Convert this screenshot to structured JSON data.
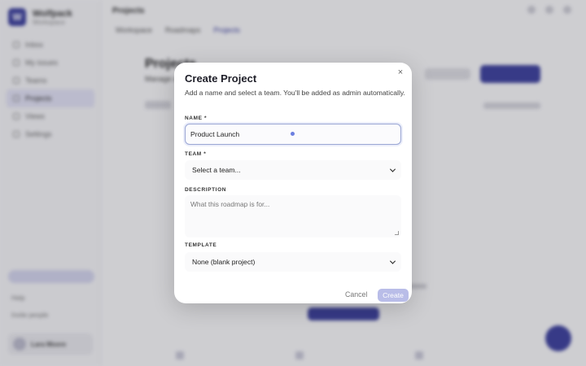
{
  "background": {
    "brand": {
      "name": "Wolfpack",
      "sub": "Workspace"
    },
    "sidebar": {
      "items": [
        {
          "label": "Inbox",
          "icon": "inbox-icon"
        },
        {
          "label": "My issues",
          "icon": "user-icon"
        },
        {
          "label": "Teams",
          "icon": "team-icon"
        },
        {
          "label": "Projects",
          "icon": "folder-icon",
          "active": true
        },
        {
          "label": "Views",
          "icon": "layers-icon"
        },
        {
          "label": "Settings",
          "icon": "gear-icon"
        }
      ],
      "upgrade_label": "Upgrade plan",
      "links": [
        "Help",
        "Invite people"
      ],
      "user": {
        "name": "Lara Moore"
      }
    },
    "topbar": {
      "title": "Projects"
    },
    "subnav": [
      "Workspace",
      "Roadmaps",
      "Projects"
    ],
    "page": {
      "title": "Projects",
      "subtitle": "Manage all projects"
    }
  },
  "modal": {
    "title": "Create Project",
    "close_symbol": "×",
    "description": "Add a name and select a team. You'll be added as admin automatically.",
    "name": {
      "label": "NAME",
      "required": "*",
      "value": "Product Launch"
    },
    "team": {
      "label": "TEAM",
      "required": "*",
      "selected": "Select a team..."
    },
    "description_field": {
      "label": "DESCRIPTION",
      "placeholder": "What this roadmap is for..."
    },
    "template": {
      "label": "TEMPLATE",
      "selected": "None (blank project)"
    },
    "cancel_label": "Cancel",
    "create_label": "Create"
  },
  "colors": {
    "accent": "#3b3f9a",
    "create_disabled": "#b9bde8",
    "focus_ring": "#9aa6d4"
  }
}
